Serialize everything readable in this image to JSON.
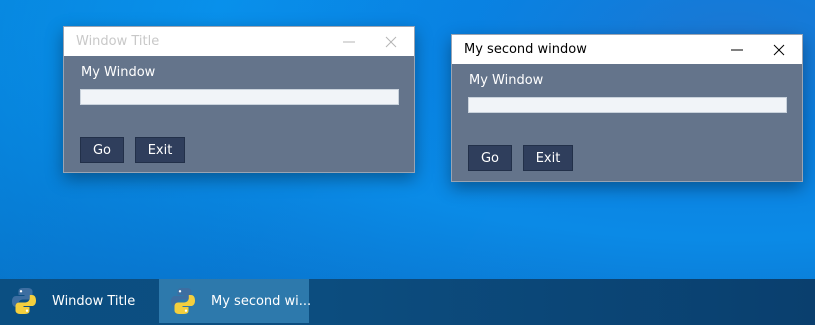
{
  "windows": [
    {
      "title": "Window Title",
      "label": "My Window",
      "input_value": "",
      "go_label": "Go",
      "exit_label": "Exit",
      "title_color": "#c8c8c8",
      "active": false
    },
    {
      "title": "My second window",
      "label": "My Window",
      "input_value": "",
      "go_label": "Go",
      "exit_label": "Exit",
      "title_color": "#000000",
      "active": true
    }
  ],
  "taskbar": {
    "items": [
      {
        "label": "Window Title",
        "icon": "python-icon",
        "active": false
      },
      {
        "label": "My second wi...",
        "icon": "python-icon",
        "active": true
      }
    ]
  },
  "colors": {
    "window_body": "#64748b",
    "button": "#2f3e5c",
    "taskbar": "#0b4f82",
    "taskbar_active": "#2d79ac"
  }
}
